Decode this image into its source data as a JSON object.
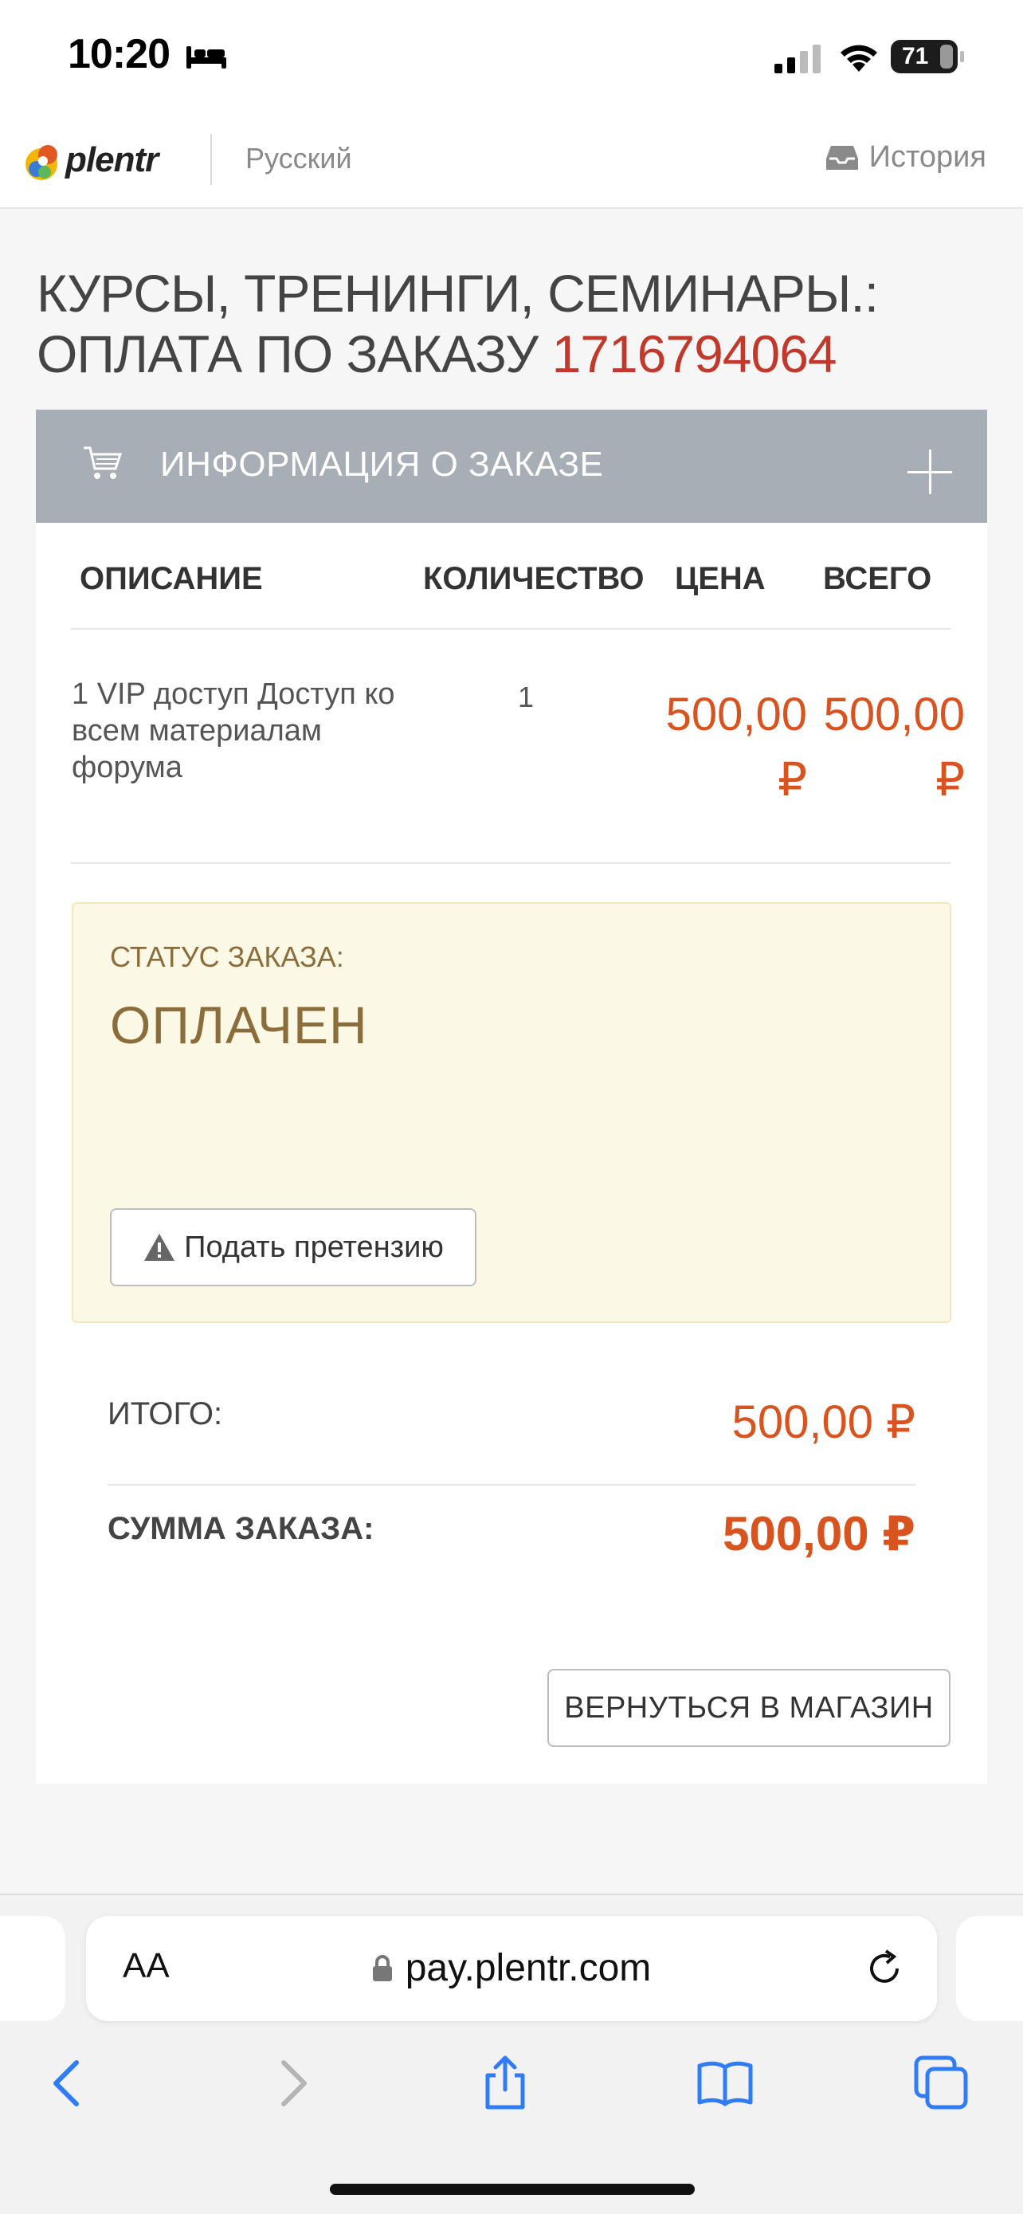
{
  "status_bar": {
    "time": "10:20",
    "battery": "71"
  },
  "header": {
    "logo_text": "plentr",
    "language": "Русский",
    "history_label": "История"
  },
  "page": {
    "title": "КУРСЫ, ТРЕНИНГИ, СЕМИНАРЫ.: ОПЛАТА ПО ЗАКАЗУ",
    "order_number": "1716794064"
  },
  "order": {
    "section_title": "ИНФОРМАЦИЯ О ЗАКАЗЕ",
    "columns": [
      "ОПИСАНИЕ",
      "КОЛИЧЕСТВО",
      "ЦЕНА",
      "ВСЕГО"
    ],
    "items": [
      {
        "description": "1 VIP доступ Доступ ко всем материалам форума",
        "quantity": "1",
        "price": "500,00 ₽",
        "total": "500,00 ₽"
      }
    ],
    "status_label": "СТАТУС ЗАКАЗА:",
    "status_value": "ОПЛАЧЕН",
    "claim_button": "Подать претензию",
    "subtotal_label": "ИТОГО:",
    "subtotal_value": "500,00 ₽",
    "grand_total_label": "СУММА ЗАКАЗА:",
    "grand_total_value": "500,00 ₽",
    "back_button": "ВЕРНУТЬСЯ В МАГАЗИН"
  },
  "browser": {
    "text_size_label": "AA",
    "url": "pay.plentr.com"
  },
  "colors": {
    "accent_price": "#d9531e",
    "order_number": "#c0392b",
    "card_header": "#a8aeb5",
    "status_bg": "#fbf8e6",
    "ios_blue": "#2f7cf6"
  }
}
